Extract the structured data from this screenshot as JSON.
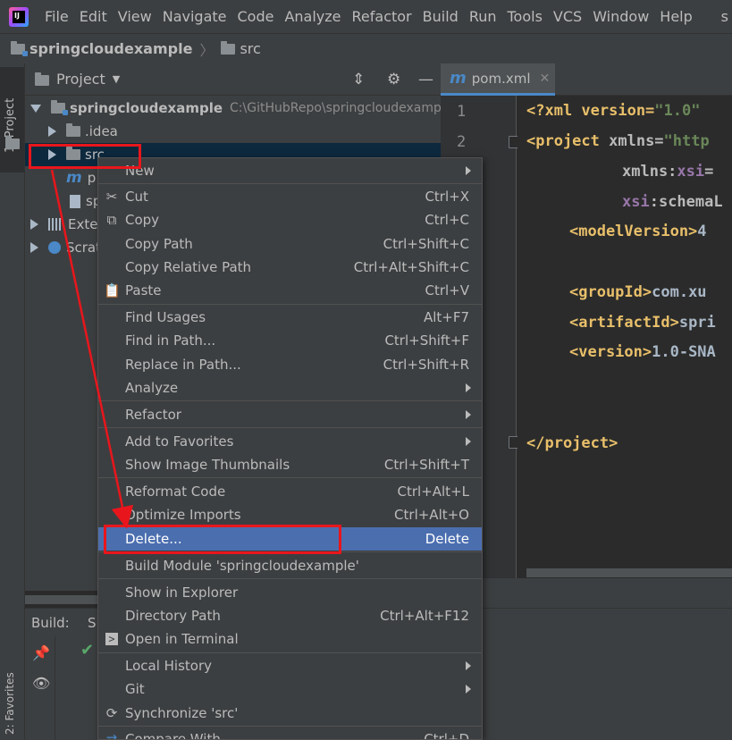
{
  "menubar": {
    "items": [
      "File",
      "Edit",
      "View",
      "Navigate",
      "Code",
      "Analyze",
      "Refactor",
      "Build",
      "Run",
      "Tools",
      "VCS",
      "Window",
      "Help"
    ],
    "trailing": "s"
  },
  "breadcrumb": {
    "project": "springcloudexample",
    "folder": "src"
  },
  "left_strip": {
    "project_tab": "1: Project",
    "favorites_tab": "2: Favorites"
  },
  "project_panel": {
    "title": "Project",
    "tree": {
      "root_name": "springcloudexample",
      "root_path": "C:\\GitHubRepo\\springcloudexample",
      "idea": ".idea",
      "src": "src",
      "pom_partial": "p",
      "iml_partial": "sp",
      "external_partial": "Exter",
      "scratches_partial": "Scrat"
    }
  },
  "build_panel": {
    "label": "Build:",
    "tab_partial": "S"
  },
  "editor": {
    "tab_label": "pom.xml",
    "line_numbers": [
      "1",
      "2"
    ],
    "code": {
      "l1_a": "<?xml version=",
      "l1_b": "\"1.0\"",
      "l2_tag": "<project ",
      "l2_attr": "xmlns=",
      "l2_val": "\"http",
      "l3_ns": "xmlns:",
      "l3_attr": "xsi",
      "l3_eq": "=",
      "l4_ns": "xsi",
      "l4_attr": ":schema",
      "l4_tail": "L",
      "l5_tag": "<modelVersion>",
      "l5_val": "4",
      "l6_tag": "<groupId>",
      "l6_val": "com.xu",
      "l7_tag": "<artifactId>",
      "l7_val": "spri",
      "l8_tag": "<version>",
      "l8_val": "1.0-SNA",
      "l9_tag": "</project>"
    }
  },
  "context_menu": {
    "new": "New",
    "cut": "Cut",
    "cut_sc": "Ctrl+X",
    "copy": "Copy",
    "copy_sc": "Ctrl+C",
    "copy_path": "Copy Path",
    "copy_path_sc": "Ctrl+Shift+C",
    "copy_rel": "Copy Relative Path",
    "copy_rel_sc": "Ctrl+Alt+Shift+C",
    "paste": "Paste",
    "paste_sc": "Ctrl+V",
    "find_usages": "Find Usages",
    "find_usages_sc": "Alt+F7",
    "find_in_path": "Find in Path...",
    "find_in_path_sc": "Ctrl+Shift+F",
    "replace_in_path": "Replace in Path...",
    "replace_in_path_sc": "Ctrl+Shift+R",
    "analyze": "Analyze",
    "refactor": "Refactor",
    "add_fav": "Add to Favorites",
    "show_thumbs": "Show Image Thumbnails",
    "show_thumbs_sc": "Ctrl+Shift+T",
    "reformat": "Reformat Code",
    "reformat_sc": "Ctrl+Alt+L",
    "optimize": "Optimize Imports",
    "optimize_sc": "Ctrl+Alt+O",
    "delete": "Delete...",
    "delete_sc": "Delete",
    "build_module": "Build Module 'springcloudexample'",
    "show_explorer": "Show in Explorer",
    "dir_path": "Directory Path",
    "dir_path_sc": "Ctrl+Alt+F12",
    "open_terminal": "Open in Terminal",
    "local_history": "Local History",
    "git": "Git",
    "sync": "Synchronize 'src'",
    "compare": "Compare With...",
    "compare_sc": "Ctrl+D"
  },
  "colors": {
    "annotation": "#e8161c",
    "selection": "#4b6eaf",
    "tree_selection": "#0d293e"
  }
}
